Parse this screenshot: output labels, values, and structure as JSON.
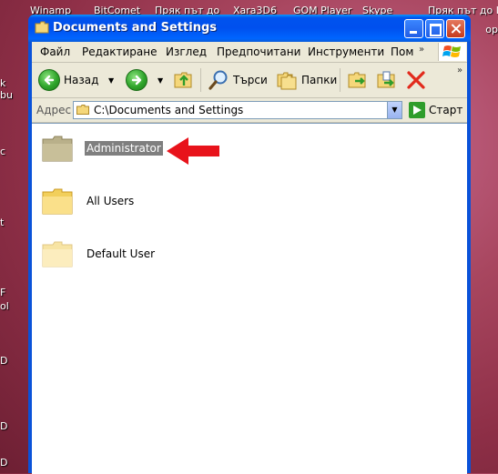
{
  "desktop": {
    "top_labels": [
      "Winamp",
      "BitComet",
      "Пряк път до",
      "Xara3D6",
      "GOM Player",
      "Skype",
      "Пряк път до Ц",
      "ор"
    ],
    "left_labels": [
      "k",
      "bu",
      "c",
      "t",
      "F",
      "ol",
      "D",
      "D",
      "D"
    ],
    "right_labels": [
      "ор"
    ]
  },
  "window": {
    "title": "Documents and Settings",
    "controls": {
      "minimize": "minimize",
      "maximize": "maximize",
      "close": "close"
    }
  },
  "menu": {
    "items": [
      "Файл",
      "Редактиране",
      "Изглед",
      "Предпочитани",
      "Инструменти",
      "Пом"
    ]
  },
  "toolbar": {
    "back_label": "Назад",
    "search_label": "Търси",
    "folders_label": "Папки"
  },
  "address": {
    "label": "Адрес",
    "value": "C:\\Documents and Settings",
    "go_label": "Старт"
  },
  "folders": [
    {
      "name": "Administrator",
      "selected": true
    },
    {
      "name": "All Users",
      "selected": false
    },
    {
      "name": "Default User",
      "selected": false
    }
  ],
  "colors": {
    "titlebar": "#0053ee",
    "selection": "#7f7f7f",
    "arrow": "#e8131b"
  }
}
